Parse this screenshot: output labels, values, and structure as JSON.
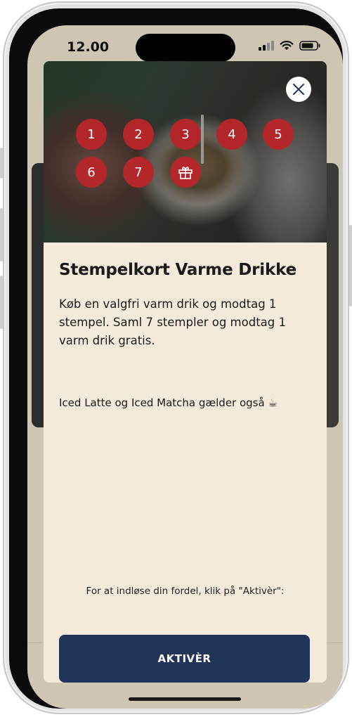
{
  "status_bar": {
    "time": "12.00"
  },
  "modal": {
    "title": "Stempelkort Varme Drikke",
    "description": "Køb en valgfri varm drik og modtag 1 stempel. Saml 7 stempler og modtag 1 varm drik gratis.",
    "note": "Iced Latte og Iced Matcha gælder også ☕",
    "redeem_hint": "For at indløse din fordel, klik på \"Aktivèr\":",
    "activate_label": "AKTIVÈR",
    "stamps": [
      "1",
      "2",
      "3",
      "4",
      "5",
      "6",
      "7"
    ],
    "reward_icon": "gift-icon",
    "close_icon": "close-icon"
  },
  "colors": {
    "stamp_red": "#b3262a",
    "button_navy": "#223558",
    "modal_bg": "#f3eadb"
  }
}
